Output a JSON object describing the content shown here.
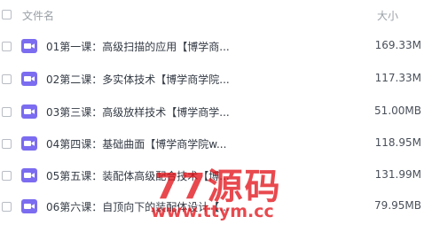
{
  "header": {
    "name_label": "文件名",
    "size_label": "大小"
  },
  "files": [
    {
      "name": "01第一课：高级扫描的应用【博学商...",
      "size": "169.33M"
    },
    {
      "name": "02第二课：多实体技术【博学商学院...",
      "size": "117.33M"
    },
    {
      "name": "03第三课：高级放样技术【博学商学...",
      "size": "51.00MB"
    },
    {
      "name": "04第四课：基础曲面【博学商学院w...",
      "size": "118.95M"
    },
    {
      "name": "05第五课：装配体高级配合技术【博...",
      "size": "131.99M"
    },
    {
      "name": "06第六课：自顶向下的装配体设计【...",
      "size": "79.95MB"
    }
  ],
  "icon": "video-file-icon",
  "colors": {
    "icon_bg": "#7b6cf0",
    "watermark": "#e2161c"
  },
  "watermark": {
    "main": "77源码",
    "url": "www.ttym.cc"
  }
}
